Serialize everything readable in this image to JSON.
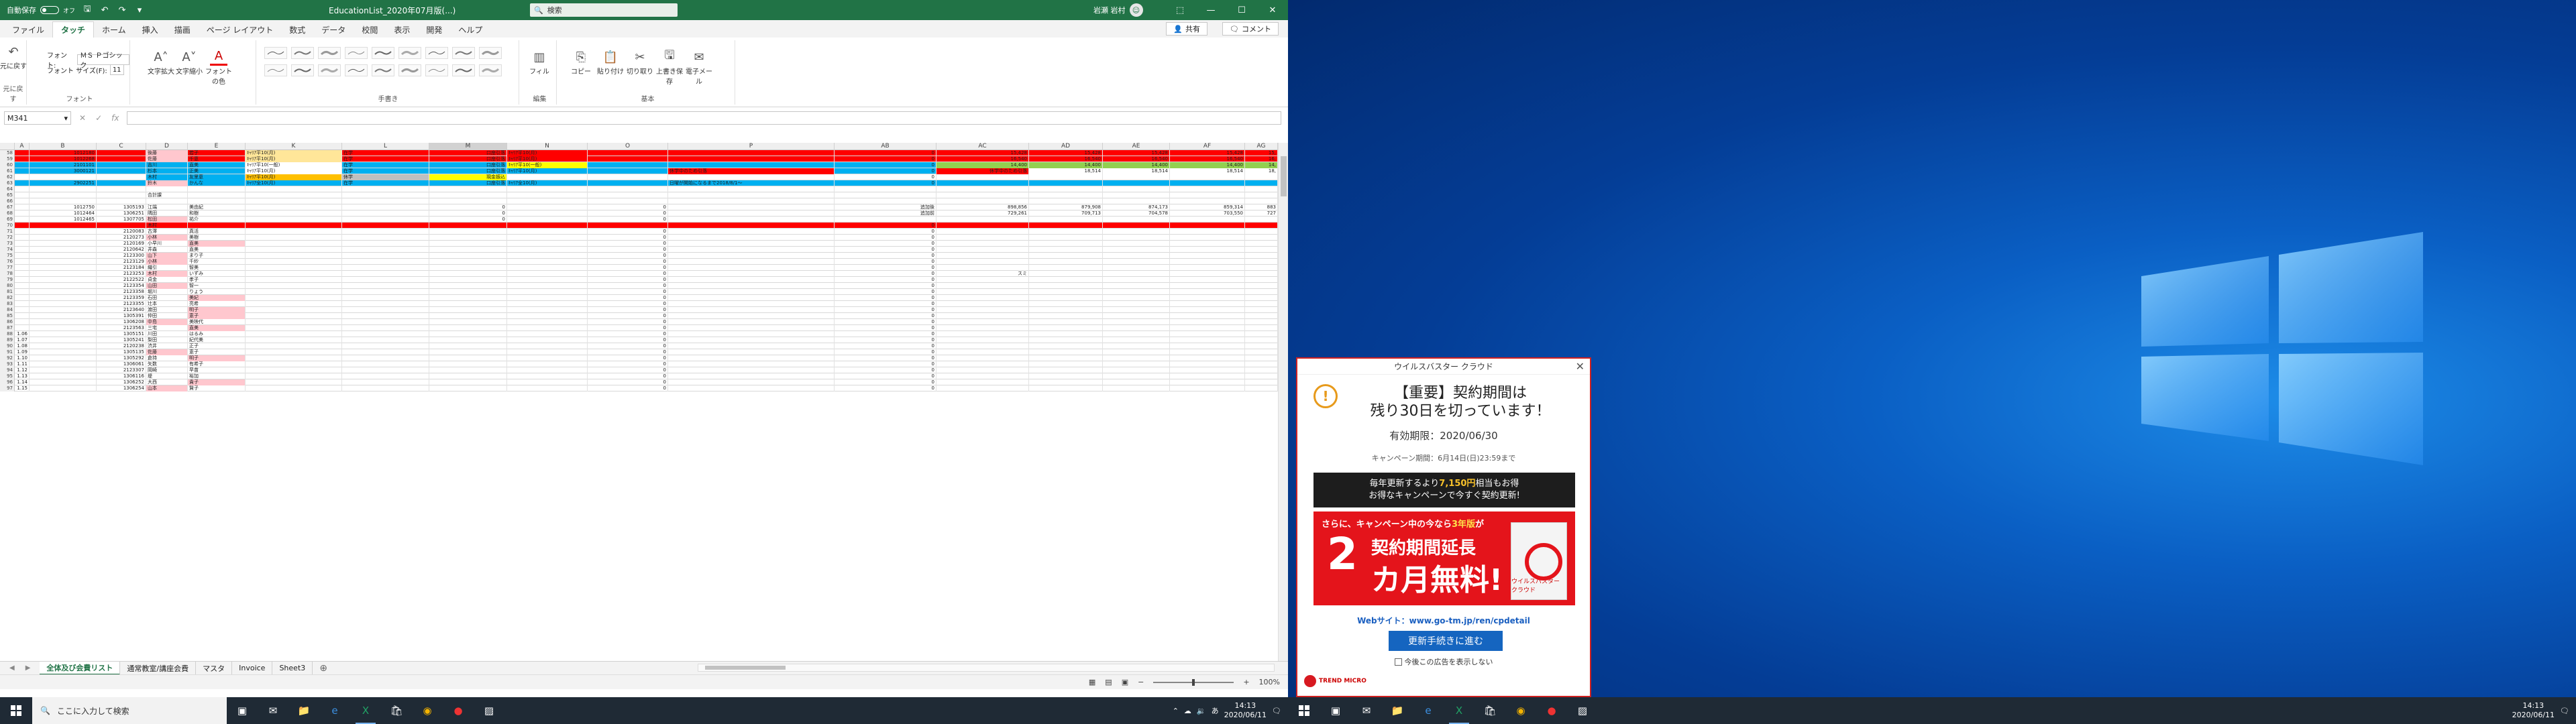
{
  "excel": {
    "autosave_label": "自動保存",
    "autosave_state": "オフ",
    "filename": "EducationList_2020年07月版(...)",
    "search_placeholder": "検索",
    "username": "岩瀬 岩村",
    "tabs": [
      "ファイル",
      "タッチ",
      "ホーム",
      "挿入",
      "描画",
      "ページ レイアウト",
      "数式",
      "データ",
      "校閲",
      "表示",
      "開発",
      "ヘルプ"
    ],
    "share_label": "共有",
    "comment_label": "コメント",
    "ribbon": {
      "undo_label": "元に戻す",
      "undo_group": "元に戻す",
      "font_label": "フォント:",
      "font_value": "ＭＳ Ｐゴシック",
      "size_label": "フォント サイズ(F):",
      "size_value": "11",
      "font_inc": "文字拡大",
      "font_dec": "文字縮小",
      "font_color": "フォントの色",
      "font_group": "フォント",
      "pens_group": "手書き",
      "lasso_label": "フィル",
      "edit_group": "編集",
      "copy_label": "コピー",
      "paste_label": "貼り付け",
      "cut_label": "切り取り",
      "overwrite_label": "上書き保存",
      "email_label": "電子メール",
      "basic_group": "基本"
    },
    "namebox": "M341",
    "columns": [
      "A",
      "B",
      "C",
      "D",
      "E",
      "K",
      "L",
      "M",
      "N",
      "O",
      "P",
      "AB",
      "AC",
      "AD",
      "AE",
      "AF",
      "AG"
    ],
    "rows": [
      {
        "n": "58",
        "bg": "#ff0000",
        "cells": {
          "b": "1012180",
          "d": "後藤",
          "e": "若子",
          "k": "ｷｬﾘｱ平10(月)",
          "l": "在学",
          "m": "口座引落",
          "n": "ｷｬﾘｱ平10(月)",
          "ab": "0",
          "ac": "15,428",
          "ad": "15,428",
          "ae": "15,428",
          "af": "15,428",
          "ag": "15,"
        },
        "hl": {
          "k": "#ffe699",
          "n": "#ff0000",
          "d": "#ffc7ce"
        }
      },
      {
        "n": "59",
        "bg": "#ff0000",
        "cells": {
          "b": "1012268",
          "d": "佐藤",
          "e": "千恵",
          "k": "ｷｬﾘｱ平10(月)",
          "l": "在学",
          "m": "口座引落",
          "n": "ｷｬﾘｱ平10(月)",
          "ab": "0",
          "ac": "16,540",
          "ad": "16,540",
          "ae": "16,540",
          "af": "16,540",
          "ag": "16,"
        },
        "hl": {
          "k": "#ffe699",
          "d": "#ffc7ce"
        }
      },
      {
        "n": "60",
        "bg": "#00b0f0",
        "cells": {
          "b": "2101101",
          "d": "吉川",
          "e": "直美",
          "k": "ｷｬﾘｱ平10(一般)",
          "l": "在学",
          "m": "口座引落",
          "n": "ｷｬﾘｱ平10(一般)",
          "ab": "0",
          "ac": "14,400",
          "ad": "14,400",
          "ae": "14,400",
          "af": "14,400",
          "ag": "14,"
        },
        "hl": {
          "k": "#ffffff",
          "n": "#ffff00",
          "ac": "#92d050",
          "ad": "#92d050",
          "ae": "#92d050",
          "af": "#92d050",
          "ag": "#92d050"
        }
      },
      {
        "n": "61",
        "bg": "#00b0f0",
        "cells": {
          "b": "3000121",
          "d": "杉本",
          "e": "正美",
          "k": "ｷｬﾘｱ平10(月)",
          "l": "在学",
          "m": "口座引落",
          "n": "ｷｬﾘｱ平10(月)",
          "p": "休学中のため引落",
          "ab": "0",
          "ac": "休学中のため引落",
          "ad": "18,514",
          "ae": "18,514",
          "af": "18,514",
          "ag": "18,"
        },
        "hl": {
          "k": "#ffffff",
          "p": "#ff0000",
          "ac": "#ff0000",
          "ad": "#ffffff",
          "ae": "#ffffff",
          "af": "#ffffff",
          "ag": "#ffffff"
        }
      },
      {
        "n": "62",
        "bg": "#ffffff",
        "cells": {
          "d": "木村",
          "e": "友里恵",
          "k": "ｷｬﾘｱ平10(月)",
          "l": "休学",
          "m": "現金振込",
          "ab": "0"
        },
        "hl": {
          "d": "#00b0f0",
          "e": "#00b0f0",
          "k": "#ffc000",
          "l": "#bfbfbf",
          "m": "#ffff00"
        }
      },
      {
        "n": "63",
        "bg": "#00b0f0",
        "cells": {
          "b": "2902251",
          "d": "鈴木",
          "e": "かんな",
          "k": "ｷｬﾘｱ全10(月)",
          "l": "在学",
          "m": "口座引落",
          "n": "ｷｬﾘｱ全10(月)",
          "p": "日曜が開始になるまで2018/8/1〜",
          "ab": "0"
        },
        "hl": {
          "d": "#ffc7ce"
        }
      },
      {
        "n": "64",
        "bg": "#ffffff",
        "cells": {}
      },
      {
        "n": "65",
        "bg": "#ffffff",
        "cells": {
          "d": "合計課"
        }
      },
      {
        "n": "66",
        "bg": "#ffffff",
        "cells": {}
      },
      {
        "n": "67",
        "bg": "#ffffff",
        "cells": {
          "b": "1012750",
          "c": "1305193",
          "d": "江端",
          "e": "美由紀",
          "m": "0",
          "o": "0",
          "ab": "追加後",
          "ac": "898,856",
          "ad": "879,908",
          "ae": "874,173",
          "af": "859,314",
          "ag": "883"
        }
      },
      {
        "n": "68",
        "bg": "#ffffff",
        "cells": {
          "b": "1012464",
          "c": "1306251",
          "d": "隅田",
          "e": "和樹",
          "m": "0",
          "o": "0",
          "ab": "追加前",
          "ac": "729,261",
          "ad": "709,713",
          "ae": "704,578",
          "af": "703,550",
          "ag": "727"
        }
      },
      {
        "n": "69",
        "bg": "#ffffff",
        "cells": {
          "b": "1012465",
          "c": "1307705",
          "d": "松田",
          "e": "祐介",
          "m": "0",
          "o": "0"
        },
        "hl": {
          "d": "#ffc7ce"
        }
      },
      {
        "n": "70",
        "bg": "#ff0000",
        "cells": {
          "d": "木村",
          "ab": "0"
        }
      },
      {
        "n": "71",
        "bg": "#ffffff",
        "cells": {
          "c": "2120083",
          "d": "古澤",
          "e": "真活",
          "o": "0",
          "ab": "0"
        }
      },
      {
        "n": "72",
        "bg": "#ffffff",
        "cells": {
          "c": "2120273",
          "d": "小林",
          "e": "美樹",
          "o": "0",
          "ab": "0"
        },
        "hl": {
          "d": "#ffc7ce"
        }
      },
      {
        "n": "73",
        "bg": "#ffffff",
        "cells": {
          "c": "2120169",
          "d": "小早川",
          "e": "直美",
          "o": "0",
          "ab": "0"
        },
        "hl": {
          "e": "#ffc7ce"
        }
      },
      {
        "n": "74",
        "bg": "#ffffff",
        "cells": {
          "c": "2120642",
          "d": "井森",
          "e": "直美",
          "o": "0",
          "ab": "0"
        }
      },
      {
        "n": "75",
        "bg": "#ffffff",
        "cells": {
          "c": "2123300",
          "d": "山下",
          "e": "まり子",
          "o": "0",
          "ab": "0"
        },
        "hl": {
          "d": "#ffc7ce"
        }
      },
      {
        "n": "76",
        "bg": "#ffffff",
        "cells": {
          "c": "2123129",
          "d": "小林",
          "e": "千紗",
          "o": "0",
          "ab": "0"
        },
        "hl": {
          "d": "#ffc7ce"
        }
      },
      {
        "n": "77",
        "bg": "#ffffff",
        "cells": {
          "c": "2123184",
          "d": "織引",
          "e": "智美",
          "o": "0",
          "ab": "0"
        }
      },
      {
        "n": "78",
        "bg": "#ffffff",
        "cells": {
          "c": "2123253",
          "d": "木村",
          "e": "いずみ",
          "o": "0",
          "ab": "0",
          "ac": "スミ"
        },
        "hl": {
          "d": "#ffc7ce"
        }
      },
      {
        "n": "79",
        "bg": "#ffffff",
        "cells": {
          "c": "2122522",
          "d": "貞金",
          "e": "孝子",
          "o": "0",
          "ab": "0"
        }
      },
      {
        "n": "80",
        "bg": "#ffffff",
        "cells": {
          "c": "2123354",
          "d": "山田",
          "e": "智一",
          "o": "0",
          "ab": "0"
        },
        "hl": {
          "d": "#ffc7ce"
        }
      },
      {
        "n": "81",
        "bg": "#ffffff",
        "cells": {
          "c": "2123358",
          "d": "堀川",
          "e": "りょう",
          "o": "0",
          "ab": "0"
        }
      },
      {
        "n": "82",
        "bg": "#ffffff",
        "cells": {
          "c": "2123359",
          "d": "石田",
          "e": "美紀",
          "o": "0",
          "ab": "0"
        },
        "hl": {
          "e": "#ffc7ce"
        }
      },
      {
        "n": "83",
        "bg": "#ffffff",
        "cells": {
          "c": "2123355",
          "d": "辻本",
          "e": "亮希",
          "o": "0",
          "ab": "0"
        }
      },
      {
        "n": "84",
        "bg": "#ffffff",
        "cells": {
          "c": "2123640",
          "d": "渡田",
          "e": "明子",
          "o": "0",
          "ab": "0"
        },
        "hl": {
          "e": "#ffc7ce"
        }
      },
      {
        "n": "85",
        "bg": "#ffffff",
        "cells": {
          "c": "1305391",
          "d": "仲田",
          "e": "恵子",
          "o": "0",
          "ab": "0"
        },
        "hl": {
          "e": "#ffc7ce"
        }
      },
      {
        "n": "86",
        "bg": "#ffffff",
        "cells": {
          "c": "1306208",
          "d": "中島",
          "e": "美映代",
          "o": "0",
          "ab": "0"
        },
        "hl": {
          "d": "#ffc7ce"
        }
      },
      {
        "n": "87",
        "bg": "#ffffff",
        "cells": {
          "c": "2123563",
          "d": "三宅",
          "e": "直美",
          "o": "0",
          "ab": "0"
        },
        "hl": {
          "e": "#ffc7ce"
        }
      },
      {
        "n": "88",
        "bg": "#ffffff",
        "cells": {
          "a": "1.06",
          "c": "1305151",
          "d": "川田",
          "e": "はるみ",
          "o": "0",
          "ab": "0"
        }
      },
      {
        "n": "89",
        "bg": "#ffffff",
        "cells": {
          "a": "1.07",
          "c": "1305241",
          "d": "梨田",
          "e": "紀代美",
          "o": "0",
          "ab": "0"
        }
      },
      {
        "n": "90",
        "bg": "#ffffff",
        "cells": {
          "a": "1.08",
          "c": "2120238",
          "d": "渋井",
          "e": "正子",
          "o": "0",
          "ab": "0"
        }
      },
      {
        "n": "91",
        "bg": "#ffffff",
        "cells": {
          "a": "1.09",
          "c": "1305135",
          "d": "佐藤",
          "e": "恵子",
          "o": "0",
          "ab": "0"
        },
        "hl": {
          "d": "#ffc7ce"
        }
      },
      {
        "n": "92",
        "bg": "#ffffff",
        "cells": {
          "a": "1.10",
          "c": "1305292",
          "d": "倉持",
          "e": "明子",
          "o": "0",
          "ab": "0"
        },
        "hl": {
          "e": "#ffc7ce"
        }
      },
      {
        "n": "93",
        "bg": "#ffffff",
        "cells": {
          "a": "1.11",
          "c": "1306061",
          "d": "矢数",
          "e": "有希子",
          "o": "0",
          "ab": "0"
        }
      },
      {
        "n": "94",
        "bg": "#ffffff",
        "cells": {
          "a": "1.12",
          "c": "2123307",
          "d": "岡崎",
          "e": "早苗",
          "o": "0",
          "ab": "0"
        }
      },
      {
        "n": "95",
        "bg": "#ffffff",
        "cells": {
          "a": "1.13",
          "c": "1306116",
          "d": "堤",
          "e": "裕加",
          "o": "0",
          "ab": "0"
        }
      },
      {
        "n": "96",
        "bg": "#ffffff",
        "cells": {
          "a": "1.14",
          "c": "1306252",
          "d": "大西",
          "e": "貴子",
          "o": "0",
          "ab": "0"
        },
        "hl": {
          "e": "#ffc7ce"
        }
      },
      {
        "n": "97",
        "bg": "#ffffff",
        "cells": {
          "a": "1.15",
          "c": "1306254",
          "d": "山本",
          "e": "賢子",
          "o": "0",
          "ab": "0"
        },
        "hl": {
          "d": "#ffc7ce"
        }
      }
    ],
    "sheet_tabs": [
      "全体及び会費リスト",
      "通常教室/講座会費",
      "マスタ",
      "Invoice",
      "Sheet3"
    ],
    "status_zoom": "100%"
  },
  "taskbar": {
    "search_placeholder": "ここに入力して検索",
    "time_left": "14:13",
    "date_left": "2020/06/11",
    "time_right": "14:13",
    "date_right": "2020/06/11",
    "ime": "あ"
  },
  "popup": {
    "title": "ウイルスバスター クラウド",
    "headline_1": "【重要】契約期間は",
    "headline_2": "残り30日を切っています！",
    "expiry": "有効期限：2020/06/30",
    "campaign": "キャンペーン期間：6月14日(日)23:59まで",
    "banner1_a": "毎年更新するより",
    "banner1_hl": "7,150円",
    "banner1_b": "相当もお得",
    "banner1_c": "お得なキャンペーンで今すぐ契約更新!",
    "banner2_a": "さらに、キャンペーン中の今なら",
    "banner2_hl": "3年版",
    "banner2_b": "が",
    "banner2_big": "2",
    "banner2_c": "契約期間延長",
    "banner2_d": "カ月無料!",
    "banner2_product": "ウイルスバスター クラウド",
    "website": "Webサイト：www.go-tm.jp/ren/cpdetail",
    "renew_button": "更新手続きに進む",
    "noshow": "今後この広告を表示しない",
    "logo": "TREND MICRO"
  }
}
